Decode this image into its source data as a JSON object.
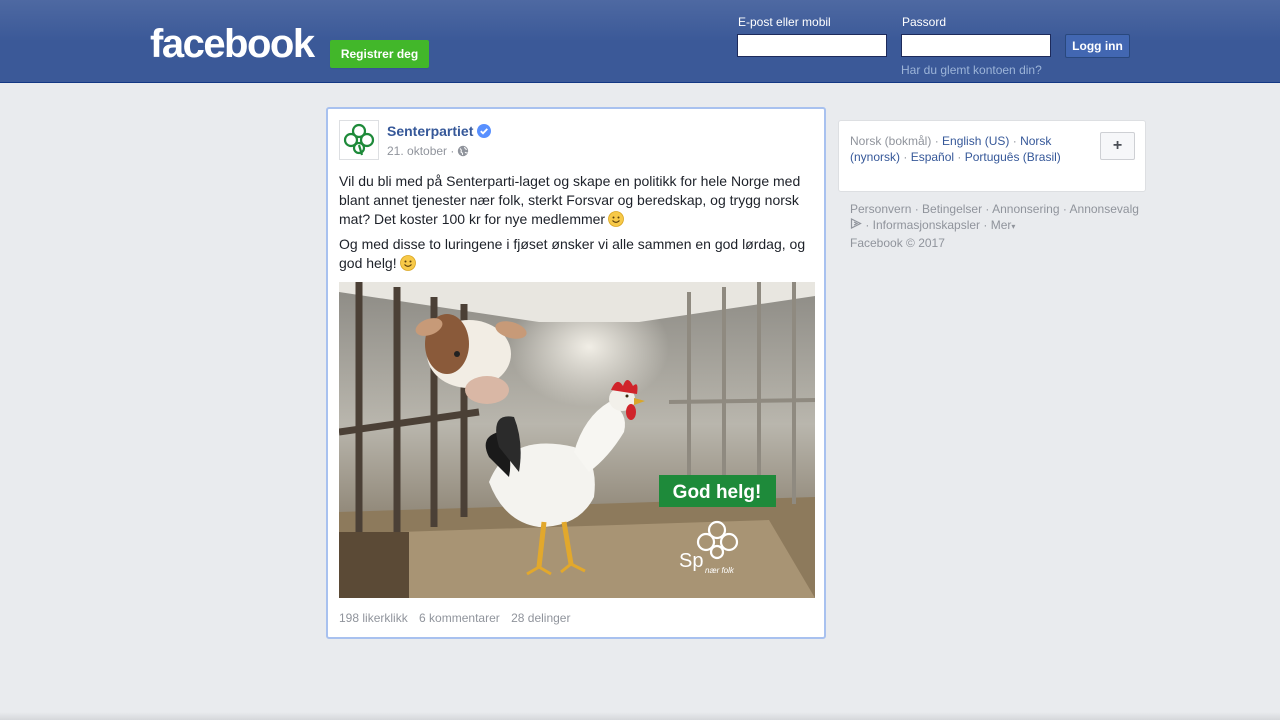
{
  "header": {
    "logo": "facebook",
    "register_label": "Registrer deg",
    "email_label": "E-post eller mobil",
    "password_label": "Passord",
    "login_label": "Logg inn",
    "forgot_label": "Har du glemt kontoen din?"
  },
  "post": {
    "page_name": "Senterpartiet",
    "date": "21. oktober ·",
    "paragraph1": "Vil du bli med på Senterparti-laget og skape en politikk for hele Norge med blant annet tjenester nær folk, sterkt Forsvar og beredskap, og trygg norsk mat? Det koster 100 kr for nye medlemmer",
    "paragraph2": "Og med disse to luringene i fjøset ønsker vi alle sammen en god lørdag, og god helg!",
    "image_banner": "God helg!",
    "image_logo_text": "Sp",
    "image_logo_sub": "nær folk",
    "likes": "198 likerklikk",
    "comments": "6 kommentarer",
    "shares": "28 delinger"
  },
  "languages": {
    "current": "Norsk (bokmål)",
    "items": [
      "English (US)",
      "Norsk (nynorsk)",
      "Español",
      "Português (Brasil)"
    ],
    "more_label": "+"
  },
  "footer": {
    "links": [
      "Personvern",
      "Betingelser",
      "Annonsering",
      "Annonsevalg",
      "Informasjonskapsler",
      "Mer"
    ],
    "copyright": "Facebook © 2017"
  },
  "colors": {
    "header_bg": "#3b5998",
    "register_green": "#42b72a",
    "link_blue": "#365899",
    "page_bg": "#e9ebee",
    "banner_green": "#1e8a3a"
  }
}
